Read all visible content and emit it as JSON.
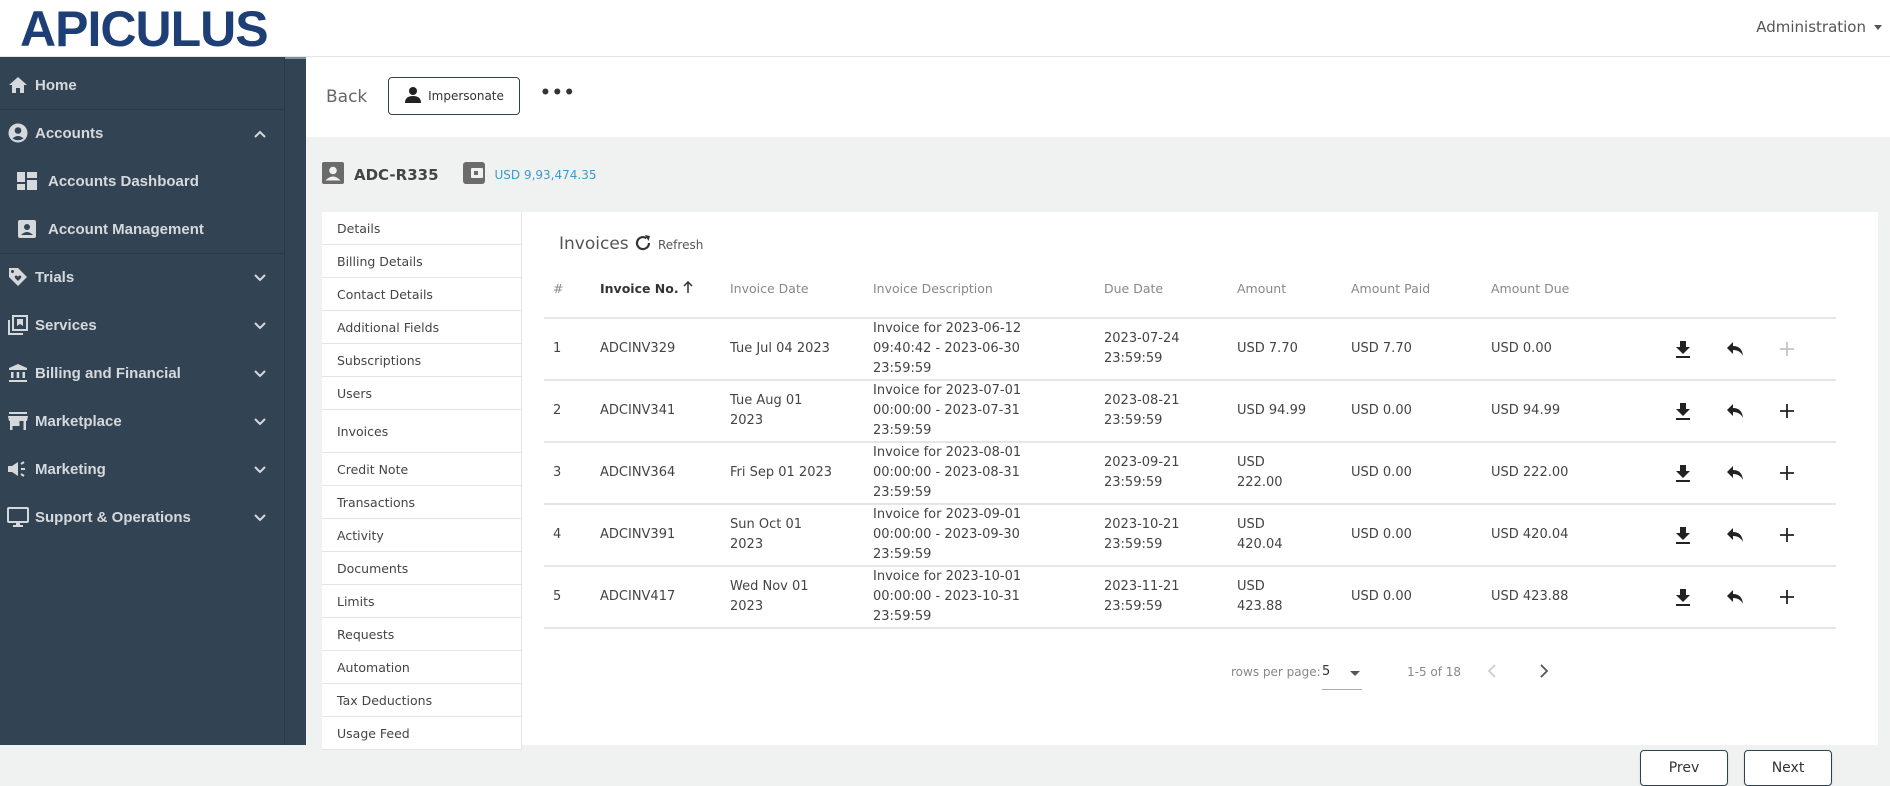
{
  "header": {
    "logo": "APICULUS",
    "admin_menu": "Administration"
  },
  "sidebar": {
    "items": [
      {
        "label": "Home",
        "icon": "home-icon"
      },
      {
        "label": "Accounts",
        "icon": "account-circle-icon",
        "expanded": true
      },
      {
        "label": "Accounts Dashboard",
        "icon": "dashboard-icon",
        "sub": true
      },
      {
        "label": "Account Management",
        "icon": "account-box-icon",
        "sub": true
      },
      {
        "label": "Trials",
        "icon": "tag-heart-icon"
      },
      {
        "label": "Services",
        "icon": "library-icon"
      },
      {
        "label": "Billing and Financial",
        "icon": "bank-icon"
      },
      {
        "label": "Marketplace",
        "icon": "store-icon"
      },
      {
        "label": "Marketing",
        "icon": "megaphone-icon"
      },
      {
        "label": "Support & Operations",
        "icon": "monitor-icon"
      }
    ]
  },
  "actionbar": {
    "back": "Back",
    "impersonate": "Impersonate",
    "more": "•••"
  },
  "account": {
    "id": "ADC-R335",
    "balance": "USD 9,93,474.35"
  },
  "subnav": {
    "items": [
      "Details",
      "Billing Details",
      "Contact Details",
      "Additional Fields",
      "Subscriptions",
      "Users",
      "Invoices",
      "Credit Note",
      "Transactions",
      "Activity",
      "Documents",
      "Limits",
      "Requests",
      "Automation",
      "Tax Deductions",
      "Usage Feed"
    ],
    "active": "Invoices"
  },
  "invoices": {
    "title": "Invoices",
    "refresh": "Refresh",
    "columns": [
      "#",
      "Invoice No.",
      "Invoice Date",
      "Invoice Description",
      "Due Date",
      "Amount",
      "Amount Paid",
      "Amount Due"
    ],
    "sorted_column": "Invoice No.",
    "rows": [
      {
        "n": "1",
        "no": "ADCINV329",
        "date": "Tue Jul 04 2023",
        "desc": "Invoice for 2023-06-12 09:40:42 - 2023-06-30 23:59:59",
        "due": "2023-07-24 23:59:59",
        "amount": "USD 7.70",
        "paid": "USD 7.70",
        "amount_due": "USD 0.00",
        "add_disabled": true
      },
      {
        "n": "2",
        "no": "ADCINV341",
        "date": "Tue Aug 01 2023",
        "desc": "Invoice for 2023-07-01 00:00:00 - 2023-07-31 23:59:59",
        "due": "2023-08-21 23:59:59",
        "amount": "USD 94.99",
        "paid": "USD 0.00",
        "amount_due": "USD 94.99",
        "add_disabled": false
      },
      {
        "n": "3",
        "no": "ADCINV364",
        "date": "Fri Sep 01 2023",
        "desc": "Invoice for 2023-08-01 00:00:00 - 2023-08-31 23:59:59",
        "due": "2023-09-21 23:59:59",
        "amount": "USD 222.00",
        "paid": "USD 0.00",
        "amount_due": "USD 222.00",
        "add_disabled": false
      },
      {
        "n": "4",
        "no": "ADCINV391",
        "date": "Sun Oct 01 2023",
        "desc": "Invoice for 2023-09-01 00:00:00 - 2023-09-30 23:59:59",
        "due": "2023-10-21 23:59:59",
        "amount": "USD 420.04",
        "paid": "USD 0.00",
        "amount_due": "USD 420.04",
        "add_disabled": false
      },
      {
        "n": "5",
        "no": "ADCINV417",
        "date": "Wed Nov 01 2023",
        "desc": "Invoice for 2023-10-01 00:00:00 - 2023-10-31 23:59:59",
        "due": "2023-11-21 23:59:59",
        "amount": "USD 423.88",
        "paid": "USD 0.00",
        "amount_due": "USD 423.88",
        "add_disabled": false
      }
    ],
    "pagination": {
      "rows_per_page_label": "rows per page:",
      "rows_per_page": "5",
      "range": "1-5 of 18"
    },
    "prev": "Prev",
    "next": "Next"
  },
  "colors": {
    "sidebar": "#324354",
    "brand": "#1e3f75",
    "balance": "#3a9ad1"
  }
}
